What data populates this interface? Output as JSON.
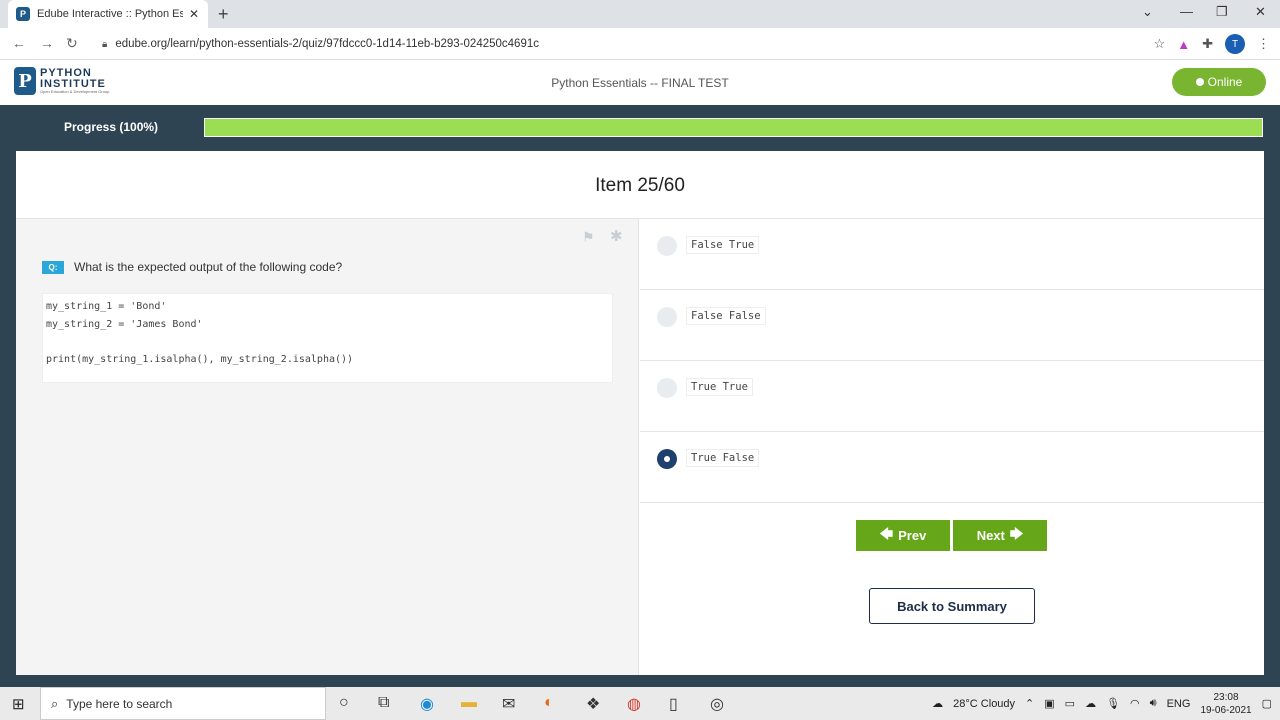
{
  "browser": {
    "tab_title": "Edube Interactive :: Python Essentials",
    "tab_favicon": "P",
    "url": "edube.org/learn/python-essentials-2/quiz/97fdccc0-1d14-11eb-b293-024250c4691c",
    "profile_initial": "T"
  },
  "site": {
    "logo_line1": "PYTHON",
    "logo_line2": "INSTITUTE",
    "logo_tagline": "Open Education & Development Group",
    "title": "Python Essentials -- FINAL TEST",
    "status": "Online"
  },
  "progress": {
    "label": "Progress (100%)",
    "percent": 100
  },
  "quiz": {
    "item_label": "Item 25/60",
    "question_badge": "Q:",
    "question": "What is the expected output of the following code?",
    "code": "my_string_1 = 'Bond'\nmy_string_2 = 'James Bond'\n\nprint(my_string_1.isalpha(), my_string_2.isalpha())",
    "answers": [
      {
        "text": "False True",
        "selected": false
      },
      {
        "text": "False False",
        "selected": false
      },
      {
        "text": "True True",
        "selected": false
      },
      {
        "text": "True False",
        "selected": true
      }
    ],
    "prev_label": "Prev",
    "next_label": "Next",
    "summary_label": "Back to Summary"
  },
  "taskbar": {
    "search_placeholder": "Type here to search",
    "weather": "28°C  Cloudy",
    "language": "ENG",
    "time": "23:08",
    "date": "19-06-2021"
  },
  "colors": {
    "accent_green": "#66a619",
    "progress_green": "#9bde54",
    "header_dark": "#2e4453",
    "selected_radio": "#1f3f6e"
  }
}
